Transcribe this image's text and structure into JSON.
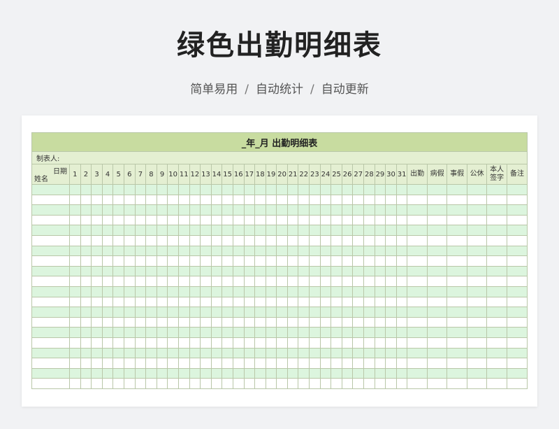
{
  "page": {
    "title": "绿色出勤明细表",
    "subtitle": [
      "简单易用",
      "自动统计",
      "自动更新"
    ],
    "separator": "/"
  },
  "sheet": {
    "title": "_年_月 出勤明细表",
    "maker_label": "制表人:",
    "corner_top": "日期",
    "corner_bottom": "姓名",
    "days": [
      "1",
      "2",
      "3",
      "4",
      "5",
      "6",
      "7",
      "8",
      "9",
      "10",
      "11",
      "12",
      "13",
      "14",
      "15",
      "16",
      "17",
      "18",
      "19",
      "20",
      "21",
      "22",
      "23",
      "24",
      "25",
      "26",
      "27",
      "28",
      "29",
      "30",
      "31"
    ],
    "summary_columns": [
      "出勤",
      "病假",
      "事假",
      "公休",
      "本人\n签字",
      "备注"
    ],
    "empty_rows": 20
  },
  "colors": {
    "title_band": "#c8dca0",
    "header_band": "#e4efd2",
    "row_green": "#dcf5de",
    "row_white": "#ffffff",
    "grid": "#b9c7a8"
  }
}
